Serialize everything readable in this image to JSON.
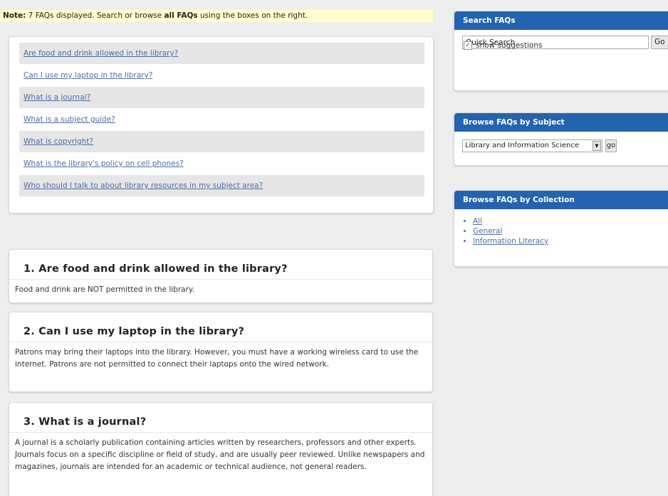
{
  "note": {
    "label": "Note:",
    "text_before": " 7 FAQs displayed. Search or browse ",
    "bold": "all FAQs",
    "text_after": " using the boxes on the right."
  },
  "faq_links": [
    "Are food and drink allowed in the library?",
    "Can I use my laptop in the library?",
    "What is a journal?",
    "What is a subject guide?",
    "What is copyright?",
    "What is the library's policy on cell phones?",
    "Who should I talk to about library resources in my subject area?"
  ],
  "answers": [
    {
      "title": "1. Are food and drink allowed in the library?",
      "body": "Food and drink are NOT permitted in the library."
    },
    {
      "title": "2. Can I use my laptop in the library?",
      "body": "Patrons may bring their laptops into the library. However, you must have a working wireless card to use the internet. Patrons are not permitted to connect their laptops onto the wired network."
    },
    {
      "title": "3. What is a journal?",
      "body": "A journal is a scholarly publication containing articles written by researchers, professors and other experts. Journals focus on a specific discipline or field of study, and are usually peer reviewed. Unlike newspapers and magazines, journals are intended for an academic or technical audience, not general readers."
    }
  ],
  "search_box": {
    "header": "Search FAQs",
    "input_value": "Quick Search",
    "go_label": "Go",
    "suggestions_label": "show suggestions",
    "suggestions_checked": true
  },
  "subject_box": {
    "header": "Browse FAQs by Subject",
    "selected": "Library and Information Science",
    "go_label": "go"
  },
  "collection_box": {
    "header": "Browse FAQs by Collection",
    "items": [
      "All",
      "General",
      "Information Literacy"
    ]
  },
  "colors": {
    "header_blue": "#2463b0",
    "link": "#4a6fa5",
    "note_bg": "#ffffcc"
  }
}
